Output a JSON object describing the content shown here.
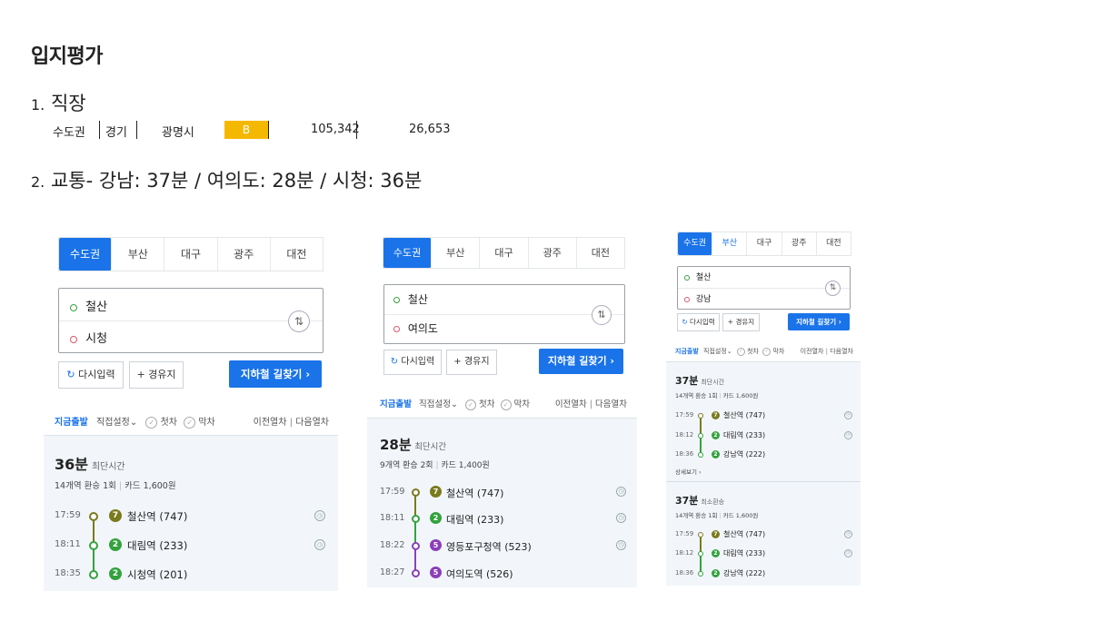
{
  "heading": "입지평가",
  "section1": {
    "num": "1.",
    "title": "직장"
  },
  "info": {
    "region": "수도권",
    "province": "경기",
    "city": "광명시",
    "grade": "B",
    "value1": "105,342",
    "value2": "26,653"
  },
  "section2": {
    "num": "2.",
    "text": "교통- 강남: 37분 / 여의도: 28분 / 시청: 36분"
  },
  "colors": {
    "accent": "#1a73e8",
    "grade": "#f5b800",
    "line1": "#7a7a1e",
    "line2": "#33a23d",
    "line5": "#8b3fb7"
  },
  "tabs": [
    "수도권",
    "부산",
    "대구",
    "광주",
    "대전"
  ],
  "common": {
    "reset": "다시입력",
    "waypoint": "경유지",
    "search": "지하철 길찾기",
    "now": "지금출발",
    "direct": "직접설정",
    "first": "첫차",
    "last": "막차",
    "prev": "이전열차",
    "next": "다음열차",
    "shortest": "최단시간",
    "least_transfer": "최소환승",
    "detail": "상세보기"
  },
  "panels": [
    {
      "from": "철산",
      "to": "시청",
      "results": [
        {
          "duration": "36분",
          "kind": "최단시간",
          "summary_a": "14개역 환승 1회",
          "summary_b": "카드 1,600원",
          "stops": [
            {
              "time": "17:59",
              "line": "7",
              "name": "철산역 (747)"
            },
            {
              "time": "18:11",
              "line": "2",
              "name": "대림역 (233)"
            },
            {
              "time": "18:35",
              "line": "2",
              "name": "시청역 (201)"
            }
          ]
        }
      ]
    },
    {
      "from": "철산",
      "to": "여의도",
      "results": [
        {
          "duration": "28분",
          "kind": "최단시간",
          "summary_a": "9개역 환승 2회",
          "summary_b": "카드 1,400원",
          "stops": [
            {
              "time": "17:59",
              "line": "7",
              "name": "철산역 (747)"
            },
            {
              "time": "18:11",
              "line": "2",
              "name": "대림역 (233)"
            },
            {
              "time": "18:22",
              "line": "5",
              "name": "영등포구청역 (523)"
            },
            {
              "time": "18:27",
              "line": "5",
              "name": "여의도역 (526)"
            }
          ]
        }
      ]
    },
    {
      "from": "철산",
      "to": "강남",
      "results": [
        {
          "duration": "37분",
          "kind": "최단시간",
          "summary_a": "14개역 환승 1회",
          "summary_b": "카드 1,600원",
          "stops": [
            {
              "time": "17:59",
              "line": "7",
              "name": "철산역 (747)"
            },
            {
              "time": "18:12",
              "line": "2",
              "name": "대림역 (233)"
            },
            {
              "time": "18:36",
              "line": "2",
              "name": "강남역 (222)"
            }
          ]
        },
        {
          "duration": "37분",
          "kind": "최소환승",
          "summary_a": "14개역 환승 1회",
          "summary_b": "카드 1,600원",
          "stops": [
            {
              "time": "17:59",
              "line": "7",
              "name": "철산역 (747)"
            },
            {
              "time": "18:12",
              "line": "2",
              "name": "대림역 (233)"
            },
            {
              "time": "18:36",
              "line": "2",
              "name": "강남역 (222)"
            }
          ]
        }
      ]
    }
  ]
}
